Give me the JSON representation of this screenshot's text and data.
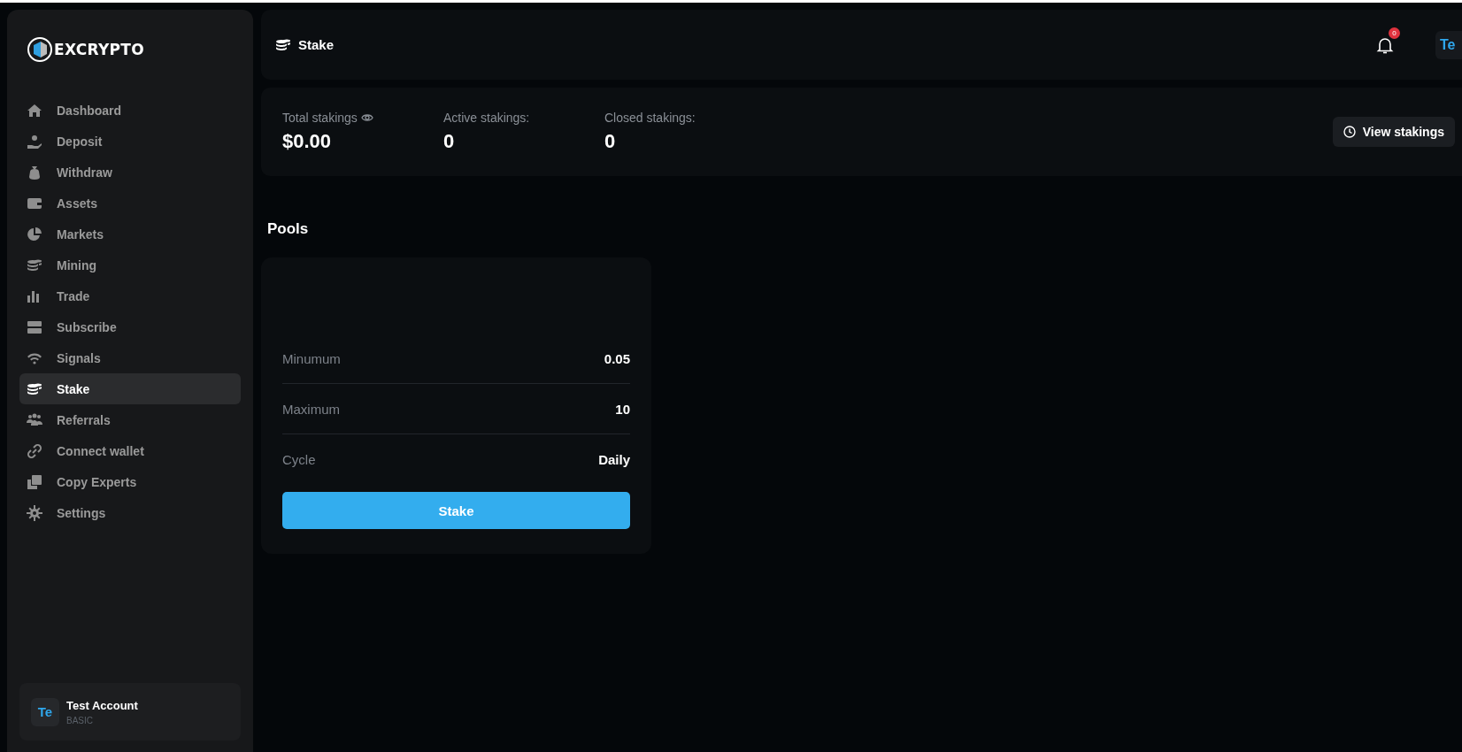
{
  "brand": {
    "name": "EXCRYPTO"
  },
  "sidebar": {
    "items": [
      {
        "label": "Dashboard",
        "kind": "home",
        "selected": false
      },
      {
        "label": "Deposit",
        "kind": "deposit",
        "selected": false
      },
      {
        "label": "Withdraw",
        "kind": "moneybag",
        "selected": false
      },
      {
        "label": "Assets",
        "kind": "wallet",
        "selected": false
      },
      {
        "label": "Markets",
        "kind": "pie",
        "selected": false
      },
      {
        "label": "Mining",
        "kind": "coins",
        "selected": false
      },
      {
        "label": "Trade",
        "kind": "bars",
        "selected": false
      },
      {
        "label": "Subscribe",
        "kind": "server",
        "selected": false
      },
      {
        "label": "Signals",
        "kind": "wifi",
        "selected": false
      },
      {
        "label": "Stake",
        "kind": "coins",
        "selected": true
      },
      {
        "label": "Referrals",
        "kind": "users",
        "selected": false
      },
      {
        "label": "Connect wallet",
        "kind": "link",
        "selected": false
      },
      {
        "label": "Copy Experts",
        "kind": "copy",
        "selected": false
      },
      {
        "label": "Settings",
        "kind": "gear",
        "selected": false
      }
    ]
  },
  "user": {
    "initials": "Te",
    "name": "Test Account",
    "plan": "BASIC"
  },
  "header": {
    "title": "Stake",
    "notification_count": "0",
    "avatar_initials": "Te"
  },
  "stats": [
    {
      "label": "Total stakings",
      "value": "$0.00",
      "kind": "eye"
    },
    {
      "label": "Active stakings:",
      "value": "0",
      "kind": "plain"
    },
    {
      "label": "Closed stakings:",
      "value": "0",
      "kind": "plain"
    }
  ],
  "view_button": "View stakings",
  "pools_title": "Pools",
  "pools": [
    {
      "rows": [
        {
          "label": "Minumum",
          "value": "0.05"
        },
        {
          "label": "Maximum",
          "value": "10"
        },
        {
          "label": "Cycle",
          "value": "Daily"
        }
      ],
      "button": "Stake"
    }
  ]
}
